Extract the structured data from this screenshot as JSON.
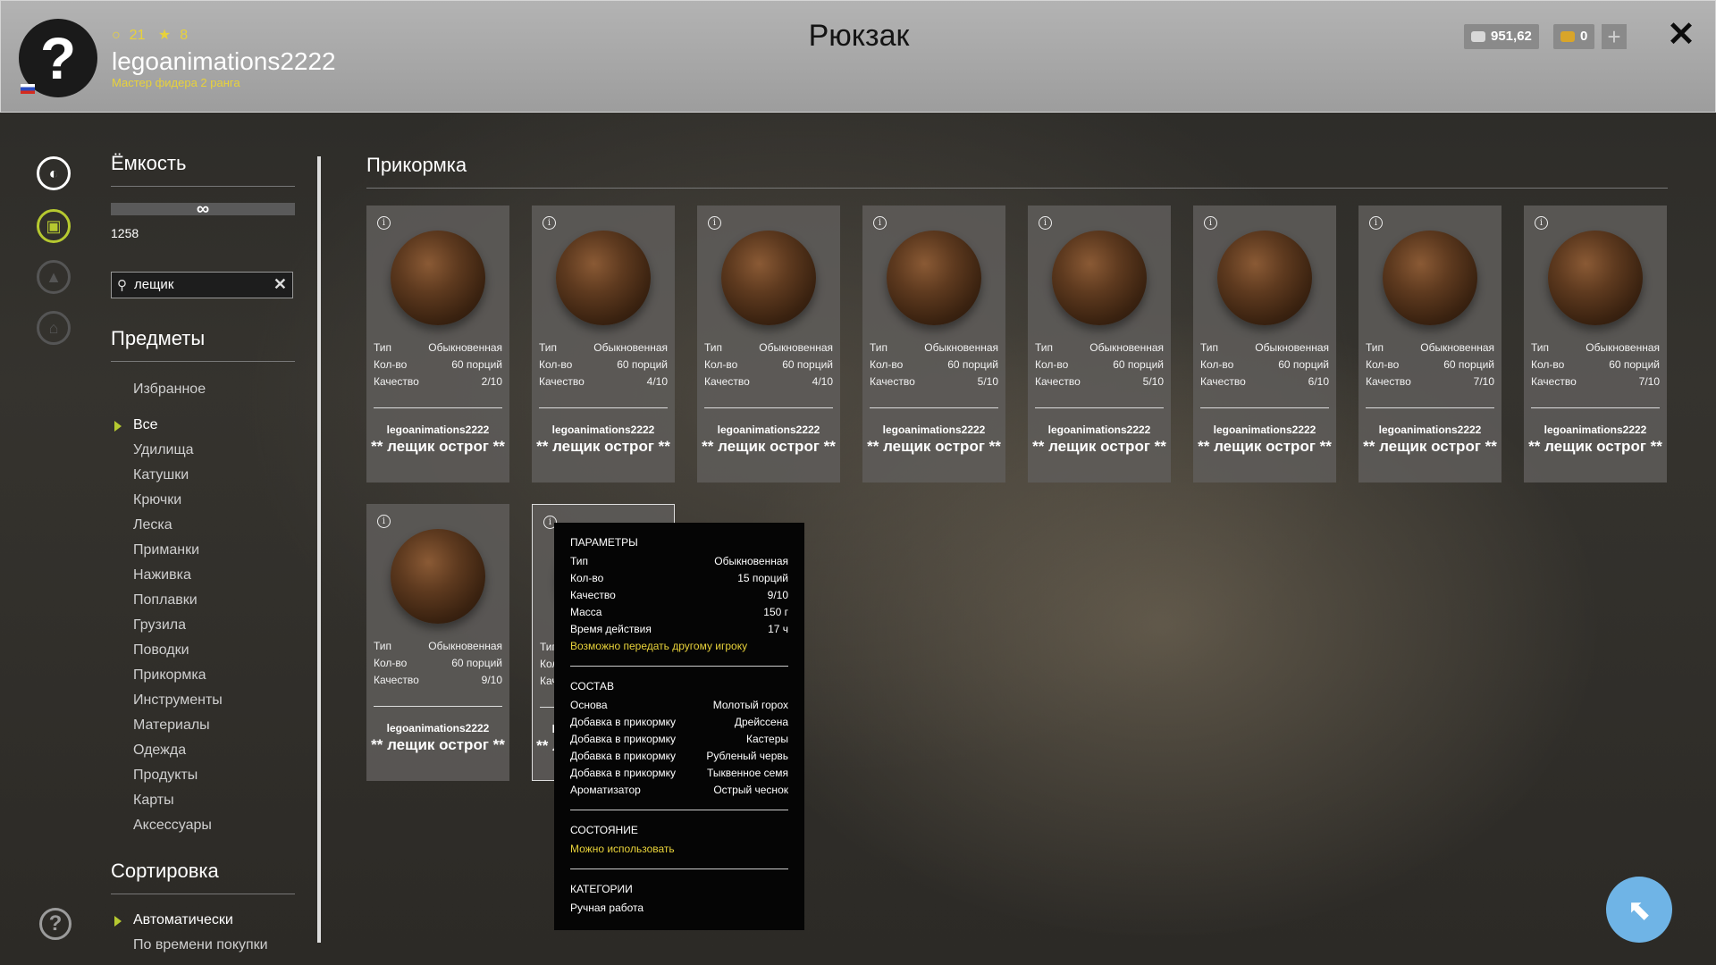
{
  "header": {
    "avatar_symbol": "?",
    "level": "21",
    "stars": "8",
    "username": "legoanimations2222",
    "rank": "Мастер фидера 2 ранга",
    "title": "Рюкзак",
    "silver": "951,62",
    "gold": "0",
    "add_symbol": "+",
    "close_symbol": "✕"
  },
  "sidebar": {
    "capacity_title": "Ёмкость",
    "capacity_symbol": "∞",
    "capacity_count": "1258",
    "search_value": "лещик",
    "items_title": "Предметы",
    "favorites": "Избранное",
    "categories": [
      "Все",
      "Удилища",
      "Катушки",
      "Крючки",
      "Леска",
      "Приманки",
      "Наживка",
      "Поплавки",
      "Грузила",
      "Поводки",
      "Прикормка",
      "Инструменты",
      "Материалы",
      "Одежда",
      "Продукты",
      "Карты",
      "Аксессуары"
    ],
    "sort_title": "Сортировка",
    "sort_options": [
      "Автоматически",
      "По времени покупки"
    ]
  },
  "section_title": "Прикормка",
  "labels": {
    "type": "Тип",
    "qty": "Кол-во",
    "quality": "Качество"
  },
  "cards": [
    {
      "type": "Обыкновенная",
      "qty": "60 порций",
      "quality": "2/10",
      "owner": "legoanimations2222",
      "name": "** лещик острог **"
    },
    {
      "type": "Обыкновенная",
      "qty": "60 порций",
      "quality": "4/10",
      "owner": "legoanimations2222",
      "name": "** лещик острог **"
    },
    {
      "type": "Обыкновенная",
      "qty": "60 порций",
      "quality": "4/10",
      "owner": "legoanimations2222",
      "name": "** лещик острог **"
    },
    {
      "type": "Обыкновенная",
      "qty": "60 порций",
      "quality": "5/10",
      "owner": "legoanimations2222",
      "name": "** лещик острог **"
    },
    {
      "type": "Обыкновенная",
      "qty": "60 порций",
      "quality": "5/10",
      "owner": "legoanimations2222",
      "name": "** лещик острог **"
    },
    {
      "type": "Обыкновенная",
      "qty": "60 порций",
      "quality": "6/10",
      "owner": "legoanimations2222",
      "name": "** лещик острог **"
    },
    {
      "type": "Обыкновенная",
      "qty": "60 порций",
      "quality": "7/10",
      "owner": "legoanimations2222",
      "name": "** лещик острог **"
    },
    {
      "type": "Обыкновенная",
      "qty": "60 порций",
      "quality": "7/10",
      "owner": "legoanimations2222",
      "name": "** лещик острог **"
    },
    {
      "type": "Обыкновенная",
      "qty": "60 порций",
      "quality": "9/10",
      "owner": "legoanimations2222",
      "name": "** лещик острог **"
    },
    {
      "type": "Обыкновенная",
      "qty": "15 порций",
      "quality": "9/10",
      "owner": "legoanimations2222",
      "name": "** лещик острог **"
    }
  ],
  "tooltip": {
    "params_title": "ПАРАМЕТРЫ",
    "params": [
      {
        "k": "Тип",
        "v": "Обыкновенная"
      },
      {
        "k": "Кол-во",
        "v": "15 порций"
      },
      {
        "k": "Качество",
        "v": "9/10"
      },
      {
        "k": "Масса",
        "v": "150 г"
      },
      {
        "k": "Время действия",
        "v": "17 ч"
      }
    ],
    "transfer_note": "Возможно передать другому игроку",
    "composition_title": "СОСТАВ",
    "composition": [
      {
        "k": "Основа",
        "v": "Молотый горох"
      },
      {
        "k": "Добавка в прикормку",
        "v": "Дрейссена"
      },
      {
        "k": "Добавка в прикормку",
        "v": "Кастеры"
      },
      {
        "k": "Добавка в прикормку",
        "v": "Рубленый червь"
      },
      {
        "k": "Добавка в прикормку",
        "v": "Тыквенное семя"
      },
      {
        "k": "Ароматизатор",
        "v": "Острый чеснок"
      }
    ],
    "state_title": "СОСТОЯНИЕ",
    "state_value": "Можно использовать",
    "categories_title": "КАТЕГОРИИ",
    "categories_value": "Ручная работа"
  },
  "colors": {
    "accent": "#b6c930",
    "yellow": "#e8d23a",
    "action_button": "#6fb4e6"
  }
}
